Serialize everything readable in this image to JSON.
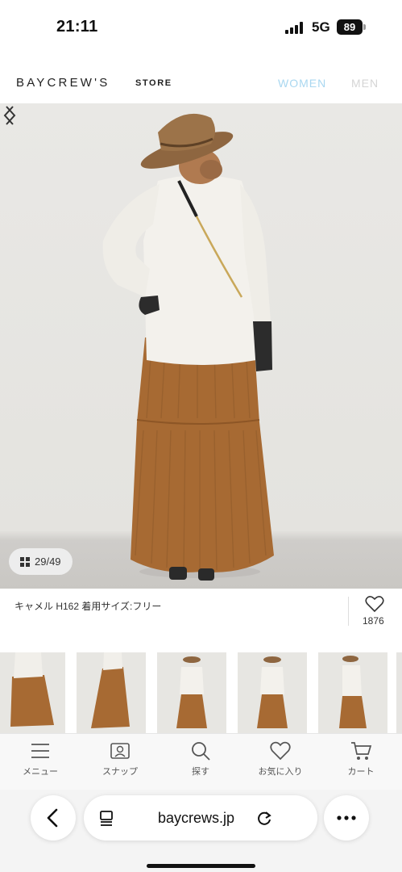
{
  "status_bar": {
    "time": "21:11",
    "network": "5G",
    "battery": "89"
  },
  "header": {
    "logo": "BAYCREW'S",
    "logo_sub": "STORE",
    "nav": [
      "WOMEN",
      "MEN"
    ]
  },
  "hero": {
    "counter": "29/49"
  },
  "product": {
    "caption": "キャメル H162 着用サイズ:フリー",
    "favorites": "1876"
  },
  "app_nav": [
    {
      "label": "メニュー",
      "icon": "menu-icon"
    },
    {
      "label": "スナップ",
      "icon": "snap-icon"
    },
    {
      "label": "探す",
      "icon": "search-icon"
    },
    {
      "label": "お気に入り",
      "icon": "heart-icon"
    },
    {
      "label": "カート",
      "icon": "cart-icon"
    }
  ],
  "browser": {
    "url": "baycrews.jp"
  },
  "colors": {
    "skirt": "#a76a33",
    "hat": "#9c7349",
    "active_nav": "#a9d7f0",
    "inactive_nav": "#d5d5d5"
  }
}
